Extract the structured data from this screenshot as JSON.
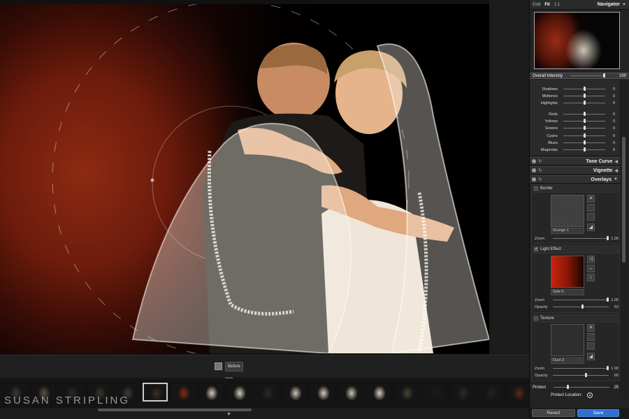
{
  "navigator": {
    "options": [
      "Grid",
      "Fit",
      "1:1"
    ],
    "active_option": "Fit",
    "title": "Navigator"
  },
  "overall_intensity": {
    "label": "Overall Intensity",
    "value": "100",
    "fraction": 1.0
  },
  "adjustments": [
    {
      "label": "Shadows",
      "value": "0",
      "fraction": 0.5
    },
    {
      "label": "Midtones",
      "value": "0",
      "fraction": 0.5
    },
    {
      "label": "Highlights",
      "value": "0",
      "fraction": 0.5
    },
    {
      "label": "Reds",
      "value": "0",
      "fraction": 0.5
    },
    {
      "label": "Yellows",
      "value": "0",
      "fraction": 0.5
    },
    {
      "label": "Greens",
      "value": "0",
      "fraction": 0.5
    },
    {
      "label": "Cyans",
      "value": "0",
      "fraction": 0.5
    },
    {
      "label": "Blues",
      "value": "0",
      "fraction": 0.5
    },
    {
      "label": "Magentas",
      "value": "0",
      "fraction": 0.5
    }
  ],
  "sections": {
    "tone_curve": "Tone Curve",
    "vignette": "Vignette",
    "overlays": "Overlays"
  },
  "border": {
    "label": "Border",
    "preset": "Grunge 1",
    "zoom_label": "Zoom",
    "zoom_value": "1.00",
    "zoom_fraction": 1.0
  },
  "light_effect": {
    "label": "Light Effect",
    "checked": "✓",
    "preset": "Side 5",
    "zoom_label": "Zoom",
    "zoom_value": "1.00",
    "zoom_fraction": 1.0,
    "opacity_label": "Opacity",
    "opacity_value": "53",
    "opacity_fraction": 0.53
  },
  "texture": {
    "label": "Texture",
    "preset": "Dust 3",
    "zoom_label": "Zoom",
    "zoom_value": "1.00",
    "zoom_fraction": 1.0,
    "opacity_label": "Opacity",
    "opacity_value": "60",
    "opacity_fraction": 0.6
  },
  "protect": {
    "label": "Protect",
    "value": "25",
    "fraction": 0.25
  },
  "protect_location": {
    "label": "Protect Location:"
  },
  "buttons": {
    "revert": "Revert",
    "save": "Save"
  },
  "before_button": "Before",
  "watermark": "SUSAN STRIPLING",
  "filmstrip": {
    "count": 19,
    "selected_index": 5,
    "thumb_colors": [
      "#3a3a3a",
      "#5c5248",
      "#2d2a25",
      "#3d352c",
      "#463a30",
      "#3a2e22",
      "#8c2a14",
      "#d8cbb8",
      "#d9ccbb",
      "#2a2a2a",
      "#cfc3b3",
      "#d6cab9",
      "#d0c4b3",
      "#dcd0bf",
      "#4a4530",
      "#1a1a1a",
      "#2b2b2b",
      "#222",
      "#5a2a1a"
    ]
  },
  "colors": {
    "accent": "#2f6fd0"
  }
}
